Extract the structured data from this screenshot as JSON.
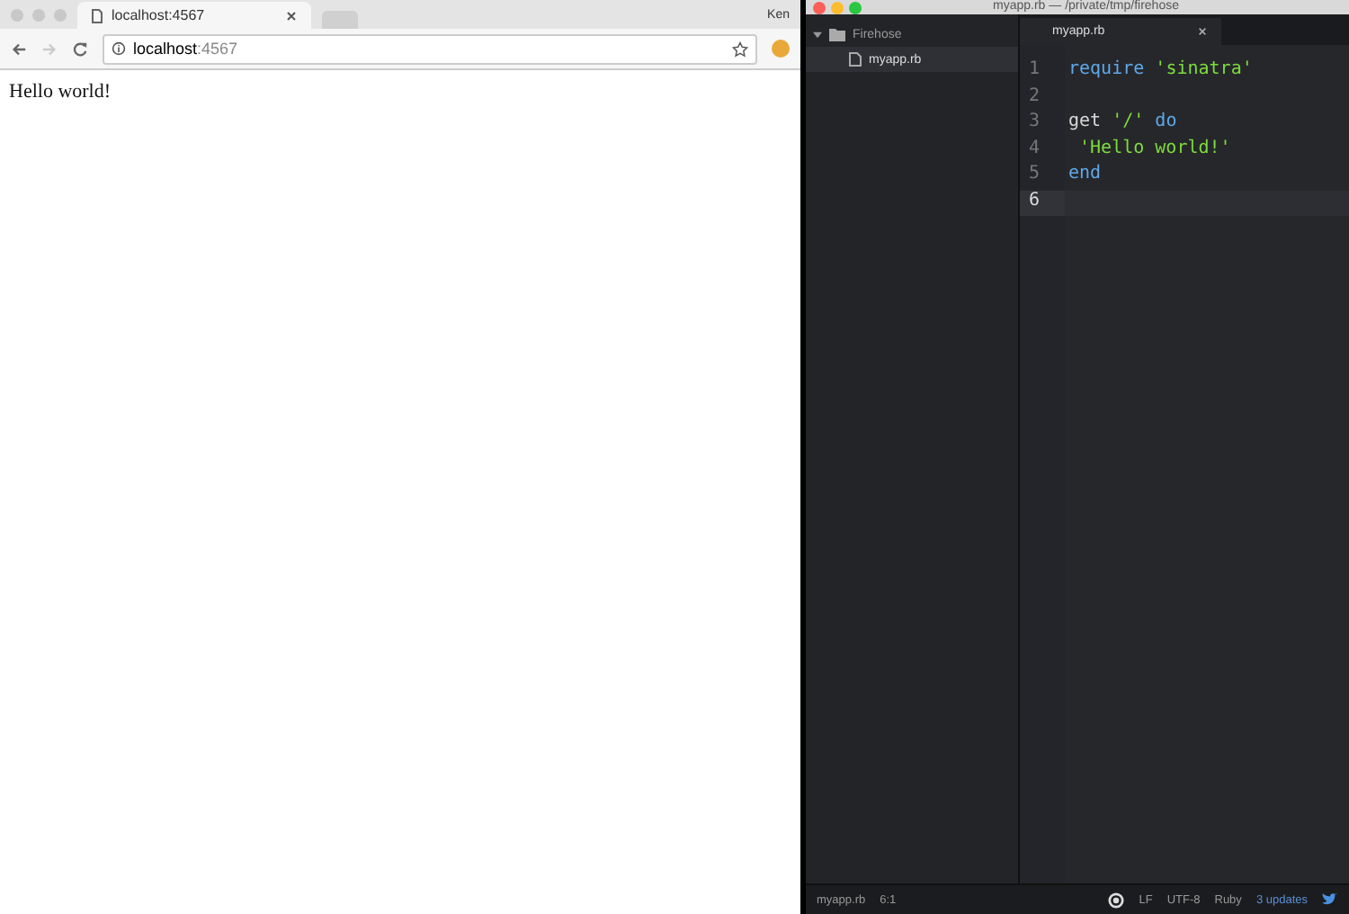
{
  "browser": {
    "tabs": [
      {
        "label": "localhost:4567",
        "selected": true
      }
    ],
    "profile": "Ken",
    "address": {
      "host": "localhost",
      "port": ":4567"
    },
    "content": "Hello world!"
  },
  "editor": {
    "title": "myapp.rb — /private/tmp/firehose",
    "tree": {
      "label": "Firehose",
      "expanded": true,
      "children": [
        {
          "label": "myapp.rb",
          "selected": true
        }
      ]
    },
    "tabs": [
      {
        "label": "myapp.rb",
        "selected": true
      }
    ],
    "lines": [
      {
        "number": "1",
        "current": false,
        "tokens": [
          {
            "kind": "keyword",
            "text": "require"
          },
          {
            "kind": "string",
            "text": " 'sinatra'"
          }
        ]
      },
      {
        "number": "2",
        "current": false
      },
      {
        "number": "3",
        "current": false,
        "tokens": [
          {
            "kind": "plain",
            "text": "get "
          },
          {
            "kind": "string",
            "text": "'/'"
          },
          {
            "kind": "keyword",
            "text": " do"
          }
        ]
      },
      {
        "number": "4",
        "current": false,
        "tokens": [
          {
            "kind": "string",
            "text": " 'Hello world!'"
          }
        ]
      },
      {
        "number": "5",
        "current": false,
        "tokens": [
          {
            "kind": "keyword",
            "text": "end"
          }
        ]
      },
      {
        "number": "6",
        "current": true
      }
    ],
    "status": {
      "file": "myapp.rb",
      "cursor": "6:1",
      "line_ending": "LF",
      "encoding": "UTF-8",
      "grammar": "Ruby",
      "updates": "3 updates"
    }
  }
}
